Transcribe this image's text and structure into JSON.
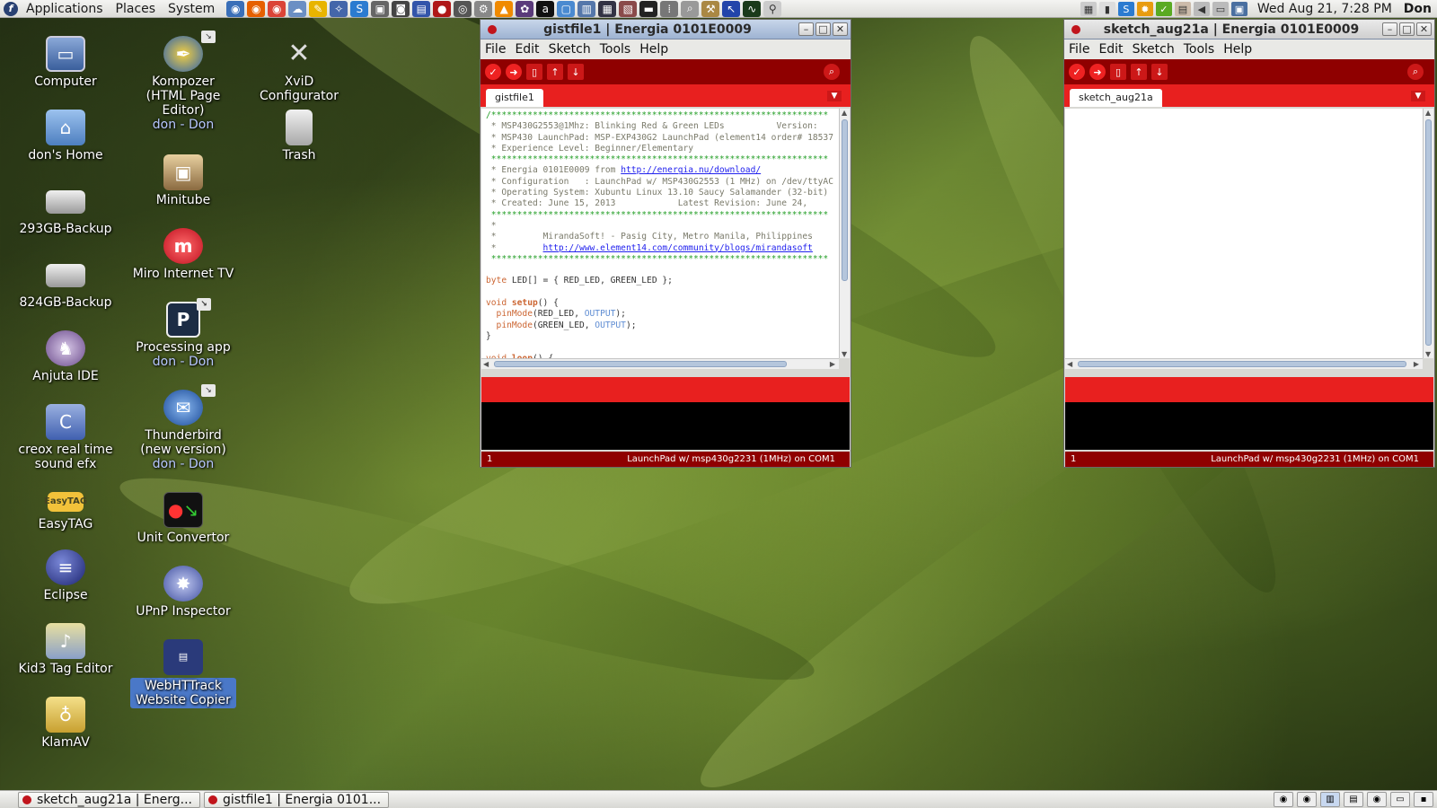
{
  "top_panel": {
    "menus": [
      "Applications",
      "Places",
      "System"
    ],
    "clock": "Wed Aug 21,  7:28 PM",
    "user": "Don"
  },
  "desktop_icons": [
    {
      "label": "Computer",
      "icon": "computer-icon"
    },
    {
      "label": "don's Home",
      "icon": "home-folder-icon"
    },
    {
      "label": "293GB-Backup",
      "icon": "drive-icon"
    },
    {
      "label": "824GB-Backup",
      "icon": "drive-icon"
    },
    {
      "label": "Anjuta IDE",
      "icon": "anjuta-icon"
    },
    {
      "label": "creox real time sound efx",
      "icon": "creox-icon"
    },
    {
      "label": "EasyTAG",
      "icon": "easytag-icon"
    },
    {
      "label": "Eclipse",
      "icon": "eclipse-icon"
    },
    {
      "label": "Kid3 Tag Editor",
      "icon": "kid3-icon"
    },
    {
      "label": "KlamAV",
      "icon": "klamav-icon"
    },
    {
      "label": "Kompozer (HTML Page Editor)",
      "sub": "don - Don",
      "icon": "kompozer-icon"
    },
    {
      "label": "Minitube",
      "icon": "minitube-icon"
    },
    {
      "label": "Miro Internet TV",
      "icon": "miro-icon"
    },
    {
      "label": "Processing app",
      "sub": "don - Don",
      "icon": "processing-icon"
    },
    {
      "label": "Thunderbird (new version)",
      "sub": "don - Don",
      "icon": "thunderbird-icon"
    },
    {
      "label": "Unit Convertor",
      "icon": "unit-convertor-icon"
    },
    {
      "label": "UPnP Inspector",
      "icon": "upnp-icon"
    },
    {
      "label": "WebHTTrack Website Copier",
      "icon": "httrack-icon"
    },
    {
      "label": "XviD Configurator",
      "icon": "xvid-icon"
    },
    {
      "label": "Trash",
      "icon": "trash-icon"
    }
  ],
  "emblem_text": "↘",
  "window1": {
    "title": "gistfile1 | Energia 0101E0009",
    "menu": [
      "File",
      "Edit",
      "Sketch",
      "Tools",
      "Help"
    ],
    "tab": "gistfile1",
    "code": {
      "l1": "/*****************************************************************",
      "l2": " * MSP430G2553@1Mhz: Blinking Red & Green LEDs          Version:",
      "l3": " * MSP430 LaunchPad: MSP-EXP430G2 LaunchPad (element14 order# 18537",
      "l4": " * Experience Level: Beginner/Elementary",
      "l5": " *****************************************************************",
      "l6a": " * Energia 0101E0009 from ",
      "l6link": "http://energia.nu/download/",
      "l7": " * Configuration   : LaunchPad w/ MSP430G2553 (1 MHz) on /dev/ttyAC",
      "l8": " * Operating System: Xubuntu Linux 13.10 Saucy Salamander (32-bit)",
      "l9": " * Created: June 15, 2013            Latest Revision: June 24,",
      "l10": " *****************************************************************",
      "l11": " *",
      "l12": " *         MirandaSoft! - Pasig City, Metro Manila, Philippines",
      "l13a": " *         ",
      "l13link": "http://www.element14.com/community/blogs/mirandasoft",
      "l14": " *****************************************************************",
      "l16kw": "byte",
      "l16rest": " LED[] = { RED_LED, GREEN_LED };",
      "l18kw": "void",
      "l18fn": " setup",
      "l18rest": "() {",
      "l19fn": "  pinMode",
      "l19a": "(RED_LED, ",
      "l19cst": "OUTPUT",
      "l19b": ");",
      "l20fn": "  pinMode",
      "l20a": "(GREEN_LED, ",
      "l20cst": "OUTPUT",
      "l20b": ");",
      "l21": "}",
      "l23kw": "void",
      "l23fn": " loop",
      "l23rest": "() {"
    },
    "status_line": "1",
    "status_board": "LaunchPad w/ msp430g2231 (1MHz) on COM1"
  },
  "window2": {
    "title": "sketch_aug21a | Energia 0101E0009",
    "menu": [
      "File",
      "Edit",
      "Sketch",
      "Tools",
      "Help"
    ],
    "tab": "sketch_aug21a",
    "status_line": "1",
    "status_board": "LaunchPad w/ msp430g2231 (1MHz) on COM1"
  },
  "taskbar": [
    {
      "label": "sketch_aug21a | Energ..."
    },
    {
      "label": "gistfile1 | Energia 0101..."
    }
  ],
  "colors": {
    "energia_toolbar": "#8f0000",
    "energia_tabbar": "#e8201f",
    "energia_status": "#8f0000"
  }
}
